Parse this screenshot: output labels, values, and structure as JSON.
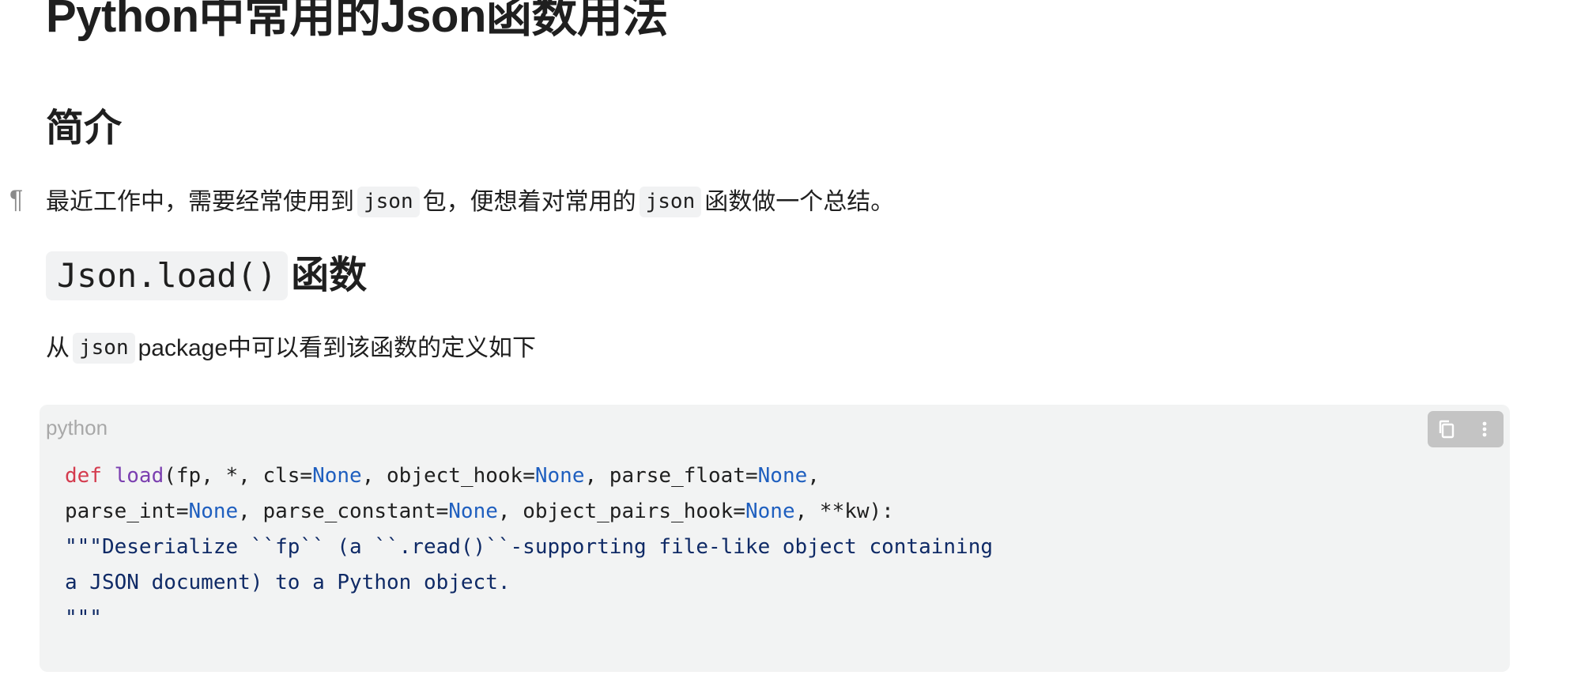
{
  "title": "Python中常用的Json函数用法",
  "sections": {
    "intro_heading": "简介",
    "intro_paragraph": {
      "pilcrow": "¶",
      "text_before": "最近工作中，需要经常使用到",
      "code1": "json",
      "text_middle": "包，便想着对常用的",
      "code2": "json",
      "text_after": "函数做一个总结。"
    },
    "load_heading": {
      "code": "Json.load()",
      "text": "函数"
    },
    "load_paragraph": {
      "text_before": "从",
      "code": "json",
      "text_after": "package中可以看到该函数的定义如下"
    }
  },
  "code_block": {
    "language": "python",
    "tokens": {
      "def": "def",
      "load": "load",
      "l1_a": "(fp, *, cls=",
      "none": "None",
      "l1_b": ", object_hook=",
      "l1_c": ", parse_float=",
      "l1_d": ",",
      "l2_a": "parse_int=",
      "l2_b": ", parse_constant=",
      "l2_c": ", object_pairs_hook=",
      "l2_d": ", **kw):",
      "l3": "\"\"\"Deserialize ``fp`` (a ``.read()``-supporting file-like object containing",
      "l4": "a JSON document) to a Python object.",
      "l5": "\"\"\""
    },
    "toolbar": {
      "copy_icon": "copy-icon",
      "more_icon": "more-vertical-icon"
    }
  },
  "colors": {
    "keyword": "#d43b4e",
    "function": "#7b3fb0",
    "constant": "#1f5fbf",
    "string": "#0f2a66",
    "code_bg": "#f2f3f3"
  }
}
